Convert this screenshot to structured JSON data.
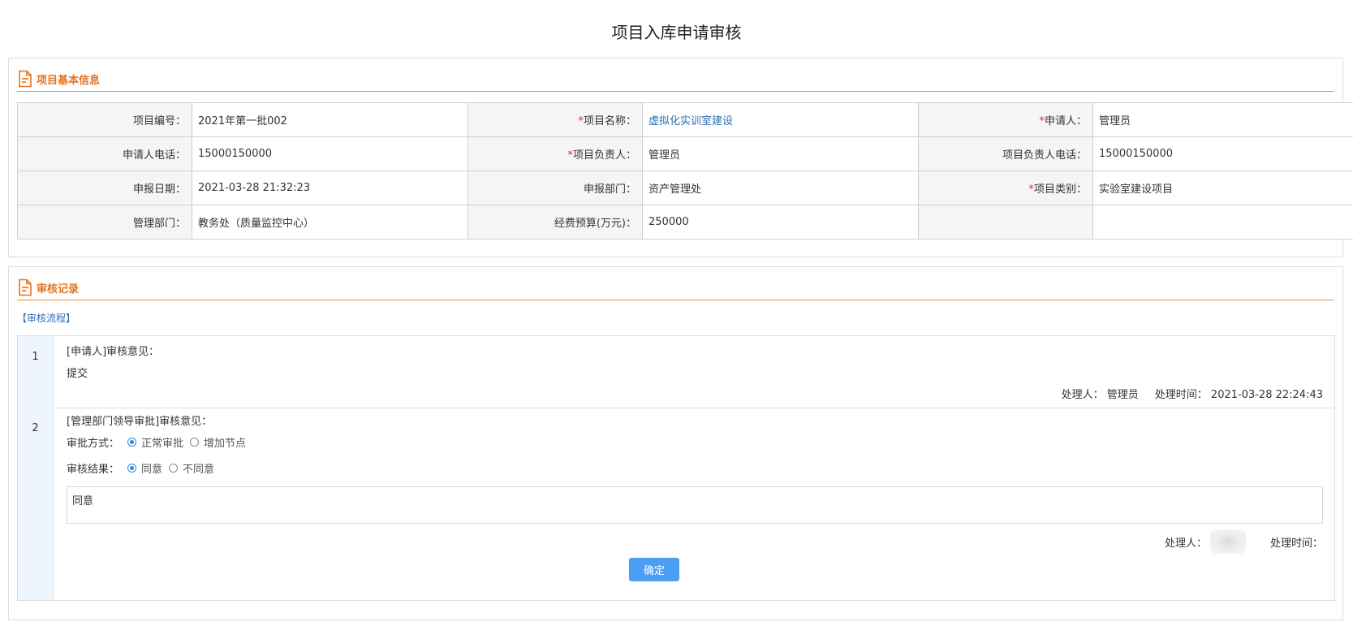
{
  "page": {
    "title": "项目入库申请审核"
  },
  "info": {
    "section_title": "项目基本信息",
    "rows": [
      [
        {
          "label": "项目编号：",
          "required": false,
          "value": "2021年第一批002",
          "link": false
        },
        {
          "label": "项目名称：",
          "required": true,
          "value": "虚拟化实训室建设",
          "link": true
        },
        {
          "label": "申请人：",
          "required": true,
          "value": "管理员",
          "link": false
        }
      ],
      [
        {
          "label": "申请人电话：",
          "required": false,
          "value": "15000150000",
          "link": false
        },
        {
          "label": "项目负责人：",
          "required": true,
          "value": "管理员",
          "link": false
        },
        {
          "label": "项目负责人电话：",
          "required": false,
          "value": "15000150000",
          "link": false
        }
      ],
      [
        {
          "label": "申报日期：",
          "required": false,
          "value": "2021-03-28 21:32:23",
          "link": false
        },
        {
          "label": "申报部门：",
          "required": false,
          "value": "资产管理处",
          "link": false
        },
        {
          "label": "项目类别：",
          "required": true,
          "value": "实验室建设项目",
          "link": false
        }
      ],
      [
        {
          "label": "管理部门：",
          "required": false,
          "value": "教务处（质量监控中心）",
          "link": false
        },
        {
          "label": "经费预算(万元)：",
          "required": false,
          "value": "250000",
          "link": false
        },
        {
          "label": "",
          "required": false,
          "value": "",
          "link": false
        }
      ]
    ]
  },
  "audit": {
    "section_title": "审核记录",
    "flow_link": "【审核流程】",
    "steps": [
      {
        "num": "1",
        "heading": "[申请人]审核意见：",
        "opinion": "提交",
        "handler_label": "处理人：",
        "handler": "管理员",
        "time_label": "处理时间：",
        "time": "2021-03-28 22:24:43"
      },
      {
        "num": "2",
        "heading": "[管理部门领导审批]审核意见：",
        "method_label": "审批方式：",
        "method_options": [
          "正常审批",
          "增加节点"
        ],
        "method_selected": 0,
        "result_label": "审核结果：",
        "result_options": [
          "同意",
          "不同意"
        ],
        "result_selected": 0,
        "opinion_value": "同意",
        "handler_label": "处理人：",
        "time_label": "处理时间：",
        "confirm_label": "确定"
      }
    ]
  },
  "colors": {
    "accent": "#e8731d",
    "link": "#2f6fb3",
    "required": "#e02a2a",
    "button": "#4a9ff5"
  }
}
